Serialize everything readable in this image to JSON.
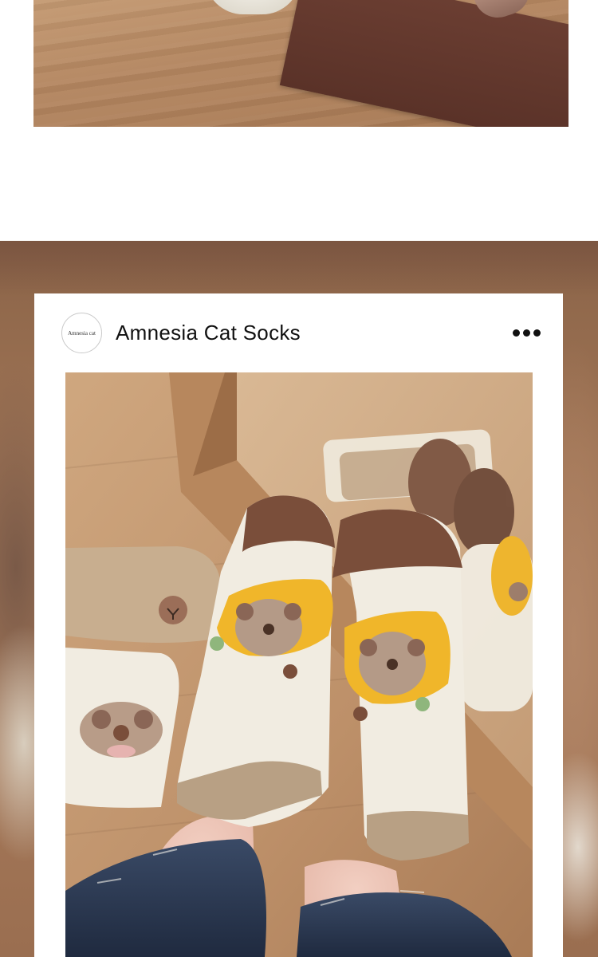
{
  "post": {
    "brand_name": "Amnesia Cat Socks",
    "avatar_text": "Amnesia cat",
    "more_icon": "more-horizontal-icon"
  },
  "images": {
    "top_photo": "socks-by-mirror-photo",
    "main_photo": "bear-banana-ankle-socks-photo"
  },
  "colors": {
    "card_background": "#ffffff",
    "brand_text": "#111111",
    "sock_cream": "#f1ece1",
    "sock_brown_heel": "#7a4e3a",
    "sock_tan_cuff": "#b8a084",
    "banana_yellow": "#f0b62a",
    "bear_brown": "#9b7c6a"
  }
}
